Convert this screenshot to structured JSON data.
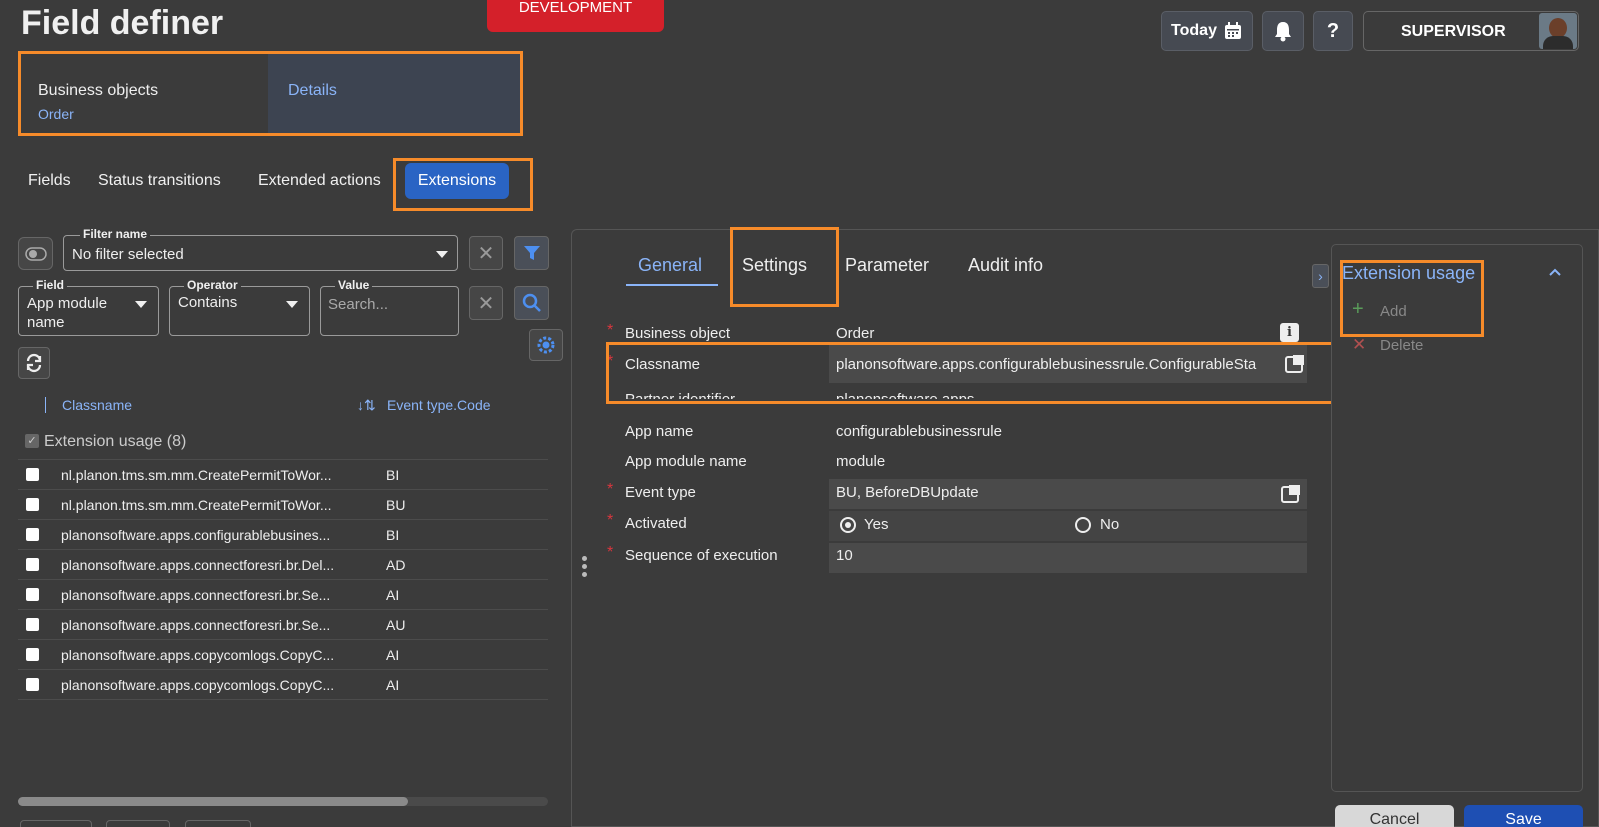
{
  "header": {
    "title": "Field definer",
    "environment_badge": "DEVELOPMENT",
    "today_label": "Today",
    "user_label": "SUPERVISOR"
  },
  "breadcrumb": {
    "business_objects_label": "Business objects",
    "business_objects_value": "Order",
    "details_label": "Details"
  },
  "top_tabs": [
    "Fields",
    "Status transitions",
    "Extended actions",
    "Extensions"
  ],
  "filter": {
    "filter_name_legend": "Filter name",
    "filter_name_value": "No filter selected",
    "field_legend": "Field",
    "field_value": "App module name",
    "operator_legend": "Operator",
    "operator_value": "Contains",
    "value_legend": "Value",
    "value_placeholder": "Search..."
  },
  "list": {
    "col_classname": "Classname",
    "col_event_type": "Event type.Code",
    "group_label": "Extension usage (8)",
    "rows": [
      {
        "classname": "nl.planon.tms.sm.mm.CreatePermitToWor...",
        "code": "BI"
      },
      {
        "classname": "nl.planon.tms.sm.mm.CreatePermitToWor...",
        "code": "BU"
      },
      {
        "classname": "planonsoftware.apps.configurablebusines...",
        "code": "BI"
      },
      {
        "classname": "planonsoftware.apps.connectforesri.br.Del...",
        "code": "AD"
      },
      {
        "classname": "planonsoftware.apps.connectforesri.br.Se...",
        "code": "AI"
      },
      {
        "classname": "planonsoftware.apps.connectforesri.br.Se...",
        "code": "AU"
      },
      {
        "classname": "planonsoftware.apps.copycomlogs.CopyC...",
        "code": "AI"
      },
      {
        "classname": "planonsoftware.apps.copycomlogs.CopyC...",
        "code": "AI"
      }
    ]
  },
  "detail_tabs": [
    "General",
    "Settings",
    "Parameter",
    "Audit info"
  ],
  "form": {
    "business_object_label": "Business object",
    "business_object_value": "Order",
    "classname_label": "Classname",
    "classname_value": "planonsoftware.apps.configurablebusinessrule.ConfigurableSta",
    "partner_label": "Partner identifier",
    "partner_value": "planonsoftware.apps",
    "app_name_label": "App name",
    "app_name_value": "configurablebusinessrule",
    "app_module_label": "App module name",
    "app_module_value": "module",
    "event_type_label": "Event type",
    "event_type_value": "BU, BeforeDBUpdate",
    "activated_label": "Activated",
    "yes_label": "Yes",
    "no_label": "No",
    "activated_selected": "Yes",
    "sequence_label": "Sequence of execution",
    "sequence_value": "10"
  },
  "usage_panel": {
    "title": "Extension usage",
    "add_label": "Add",
    "delete_label": "Delete"
  },
  "footer": {
    "cancel_label": "Cancel",
    "save_label": "Save"
  },
  "colors": {
    "accent": "#2a64c4",
    "highlight": "#f68b2a",
    "badge": "#d4202a",
    "link": "#8ab4f8"
  }
}
